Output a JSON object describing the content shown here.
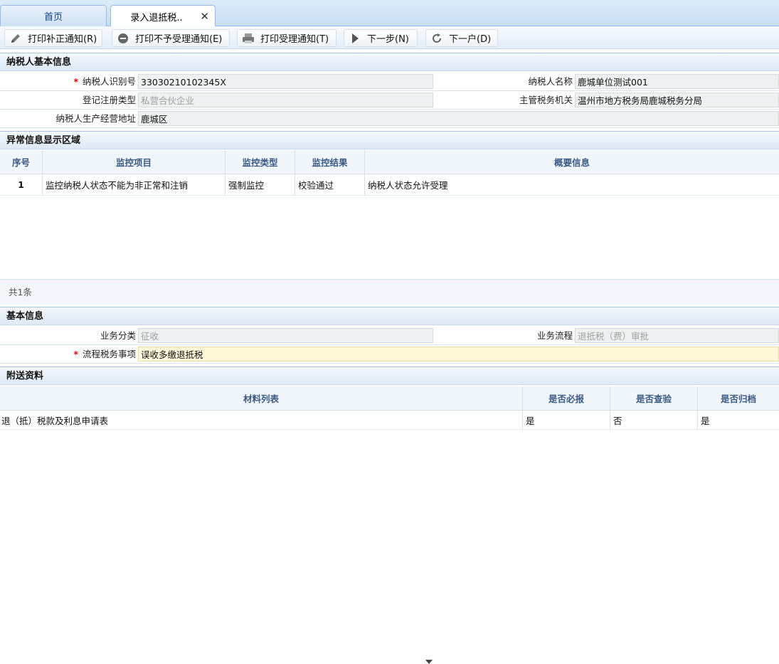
{
  "tabs": [
    {
      "label": "首页"
    },
    {
      "label": "录入退抵税.."
    }
  ],
  "toolbar": {
    "buttons": [
      {
        "label": "打印补正通知(R)",
        "icon": "pencil-icon"
      },
      {
        "label": "打印不予受理通知(E)",
        "icon": "minus-circle-icon"
      },
      {
        "label": "打印受理通知(T)",
        "icon": "printer-icon"
      },
      {
        "label": "下一步(N)",
        "icon": "play-icon"
      },
      {
        "label": "下一户(D)",
        "icon": "refresh-icon"
      }
    ]
  },
  "taxpayer": {
    "section_title": "纳税人基本信息",
    "id_label": "纳税人识别号",
    "id_value": "33030210102345X",
    "name_label": "纳税人名称",
    "name_value": "鹿城单位测试001",
    "reg_type_label": "登记注册类型",
    "reg_type_value": "私营合伙企业",
    "authority_label": "主管税务机关",
    "authority_value": "温州市地方税务局鹿城税务分局",
    "address_label": "纳税人生产经营地址",
    "address_value": "鹿城区"
  },
  "anomaly": {
    "section_title": "异常信息显示区域",
    "columns": [
      "序号",
      "监控项目",
      "监控类型",
      "监控结果",
      "概要信息"
    ],
    "rows": [
      [
        "1",
        "监控纳税人状态不能为非正常和注销",
        "强制监控",
        "校验通过",
        "纳税人状态允许受理"
      ]
    ],
    "footer": "共1条"
  },
  "basic": {
    "section_title": "基本信息",
    "category_label": "业务分类",
    "category_value": "征收",
    "flow_label": "业务流程",
    "flow_value": "退抵税（费）审批",
    "matter_label": "流程税务事项",
    "matter_value": "误收多缴退抵税"
  },
  "attachments": {
    "section_title": "附送资料",
    "columns": [
      "材料列表",
      "是否必报",
      "是否查验",
      "是否归档"
    ],
    "rows": [
      [
        "退（抵）税款及利息申请表",
        "是",
        "否",
        "是"
      ]
    ]
  },
  "colors": {
    "accent": "#99bbe8",
    "required": "#dd0000",
    "highlight_field": "#fff8d8"
  }
}
